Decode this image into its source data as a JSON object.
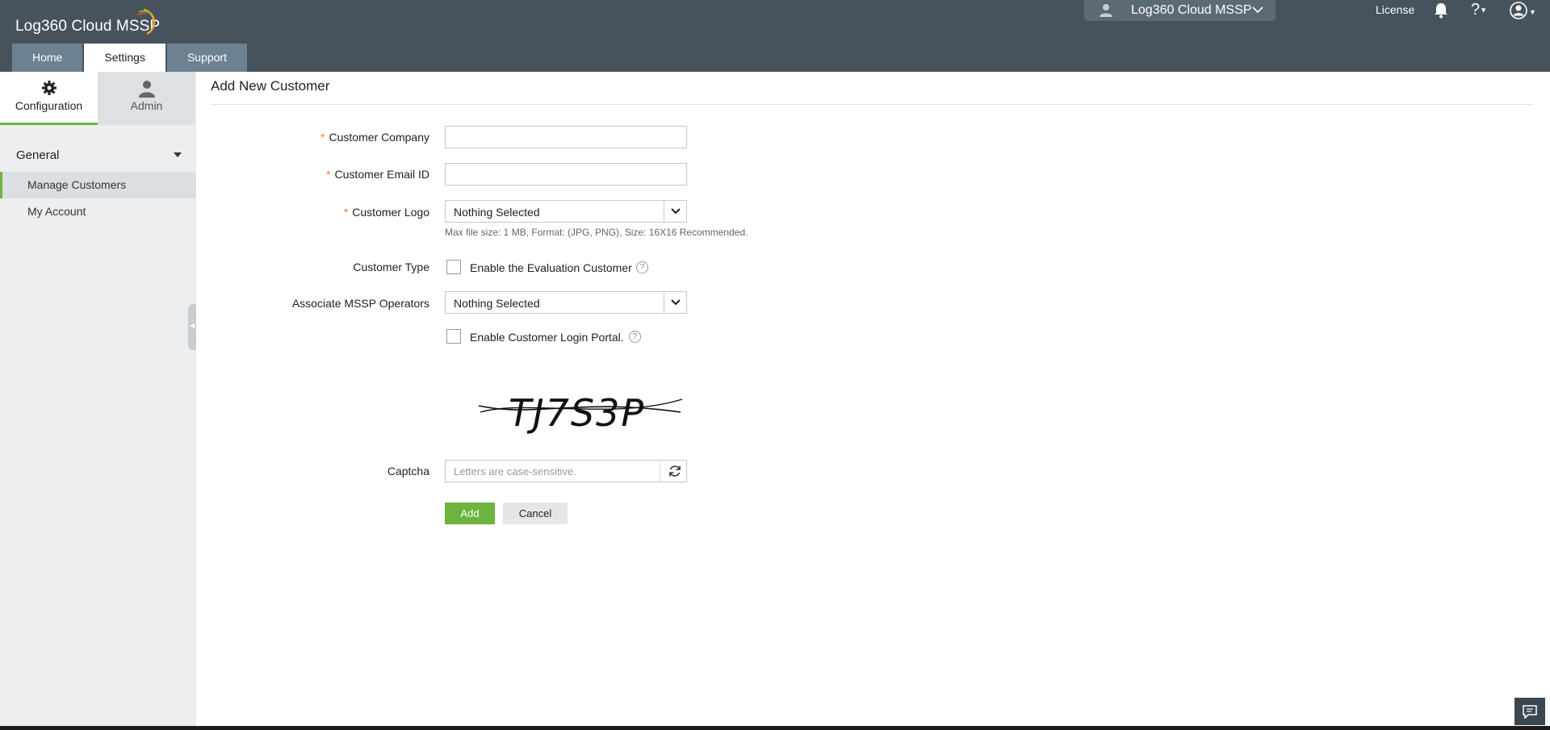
{
  "header": {
    "app_name": "Log360 Cloud MSSP",
    "tabs": [
      {
        "label": "Home"
      },
      {
        "label": "Settings"
      },
      {
        "label": "Support"
      }
    ],
    "tenant_selector": "Log360 Cloud MSSP",
    "license_link": "License",
    "help_label": "?"
  },
  "sidebar": {
    "tabs": [
      {
        "label": "Configuration"
      },
      {
        "label": "Admin"
      }
    ],
    "section_title": "General",
    "items": [
      {
        "label": "Manage Customers"
      },
      {
        "label": "My Account"
      }
    ]
  },
  "form": {
    "title": "Add New Customer",
    "required_marker": "*",
    "company_label": "Customer Company",
    "company_value": "",
    "email_label": "Customer Email ID",
    "email_value": "",
    "logo_label": "Customer Logo",
    "logo_value": "Nothing Selected",
    "logo_hint": "Max file size: 1 MB, Format: (JPG, PNG), Size: 16X16 Recommended.",
    "type_label": "Customer Type",
    "evaluation_checkbox_label": "Enable the Evaluation Customer",
    "operators_label": "Associate MSSP Operators",
    "operators_value": "Nothing Selected",
    "login_portal_checkbox_label": "Enable Customer Login Portal.",
    "captcha_text": "TJ7S3P",
    "captcha_label": "Captcha",
    "captcha_placeholder": "Letters are case-sensitive.",
    "add_button": "Add",
    "cancel_button": "Cancel",
    "help_glyph": "?"
  },
  "colors": {
    "header_bg": "#46535d",
    "accent_green": "#6db33f",
    "required_orange": "#e8773b"
  }
}
